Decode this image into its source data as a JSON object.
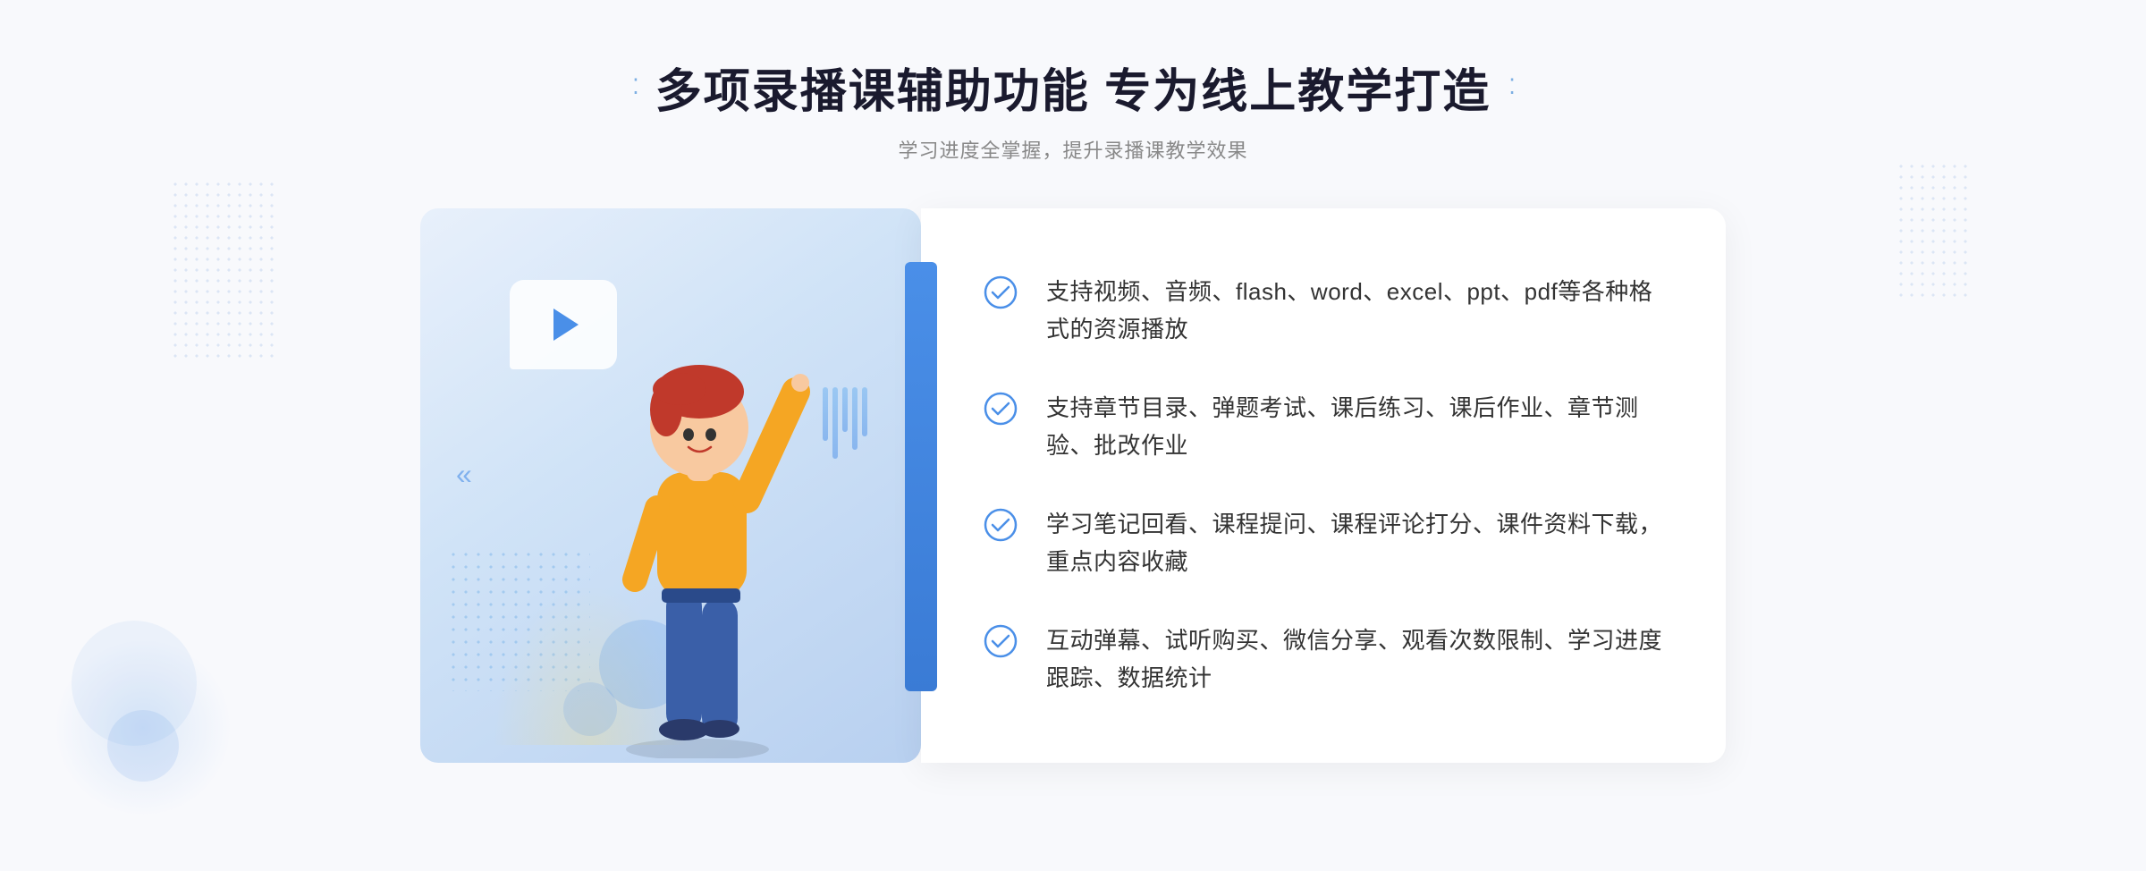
{
  "page": {
    "background_color": "#f8f9fc"
  },
  "header": {
    "title": "多项录播课辅助功能 专为线上教学打造",
    "subtitle": "学习进度全掌握，提升录播课教学效果",
    "dots_icon": "⁚"
  },
  "features": [
    {
      "id": 1,
      "text": "支持视频、音频、flash、word、excel、ppt、pdf等各种格式的资源播放"
    },
    {
      "id": 2,
      "text": "支持章节目录、弹题考试、课后练习、课后作业、章节测验、批改作业"
    },
    {
      "id": 3,
      "text": "学习笔记回看、课程提问、课程评论打分、课件资料下载，重点内容收藏"
    },
    {
      "id": 4,
      "text": "互动弹幕、试听购买、微信分享、观看次数限制、学习进度跟踪、数据统计"
    }
  ],
  "decorations": {
    "chevron_left": "«",
    "play_label": "play"
  }
}
